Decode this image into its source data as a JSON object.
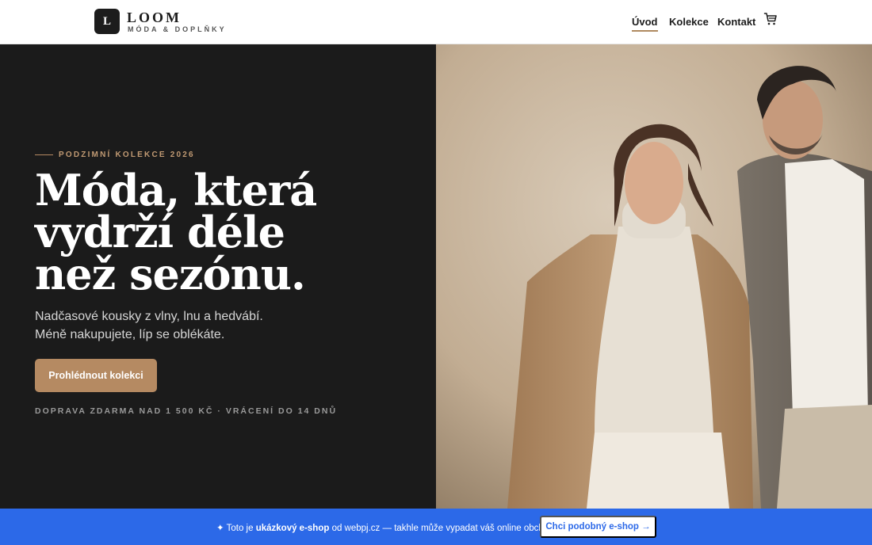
{
  "header": {
    "logo_letter": "L",
    "brand_name": "LOOM",
    "brand_tagline": "MÓDA & DOPLŇKY",
    "nav": [
      {
        "label": "Úvod",
        "active": true
      },
      {
        "label": "Kolekce",
        "active": false
      },
      {
        "label": "Kontakt",
        "active": false
      }
    ],
    "cart_icon": "cart-icon"
  },
  "hero": {
    "eyebrow": "PODZIMNÍ KOLEKCE 2026",
    "headline_lines": [
      "Móda, která",
      "vydrží déle",
      "než sezónu."
    ],
    "subcopy_lines": [
      "Nadčasové kousky z vlny, lnu a hedvábí.",
      "Méně nakupujete, líp se oblékáte."
    ],
    "cta_label": "Prohlédnout kolekci",
    "shipping_note": "DOPRAVA ZDARMA NAD 1 500 KČ · VRÁCENÍ DO 14 DNŮ"
  },
  "banner": {
    "prefix": "✦ Toto je ",
    "highlight": "ukázkový e-shop",
    "suffix": " od webpj.cz — takhle může vypadat váš online obchod.",
    "button_label": "Chci podobný e-shop →"
  },
  "colors": {
    "accent": "#b58a62",
    "dark_bg": "#1b1b1b",
    "banner_blue": "#2c69e8"
  }
}
